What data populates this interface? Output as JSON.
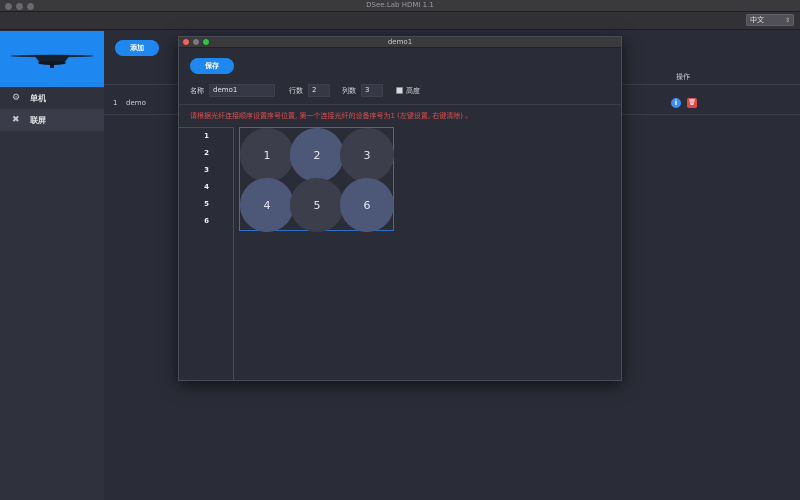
{
  "window": {
    "title": "DSee.Lab HDMI 1.1"
  },
  "toolbar": {
    "language": "中文"
  },
  "sidebar": {
    "items": [
      {
        "label": "单机",
        "icon": "gear-icon"
      },
      {
        "label": "联屏",
        "icon": "tools-icon"
      }
    ]
  },
  "main": {
    "add_label": "添加",
    "columns": {
      "operations": "操作"
    },
    "rows": [
      {
        "index": "1",
        "name": "demo"
      }
    ]
  },
  "dialog": {
    "title": "demo1",
    "save_label": "保存",
    "name_label": "名称",
    "name_value": "demo1",
    "rows_label": "行数",
    "rows_value": "2",
    "cols_label": "列数",
    "cols_value": "3",
    "highlight_label": "高度",
    "hint": "请根据光纤连接顺序设置序号位置, 第一个连接光纤的设备序号为1 (左键设置, 右键清除) 。",
    "index_list": [
      "1",
      "2",
      "3",
      "4",
      "5",
      "6"
    ],
    "grid_cells": [
      "1",
      "2",
      "3",
      "4",
      "5",
      "6"
    ]
  },
  "colors": {
    "accent": "#1e88f0",
    "danger": "#e0474c",
    "info": "#3d8ff5",
    "hint": "#e0504c"
  }
}
